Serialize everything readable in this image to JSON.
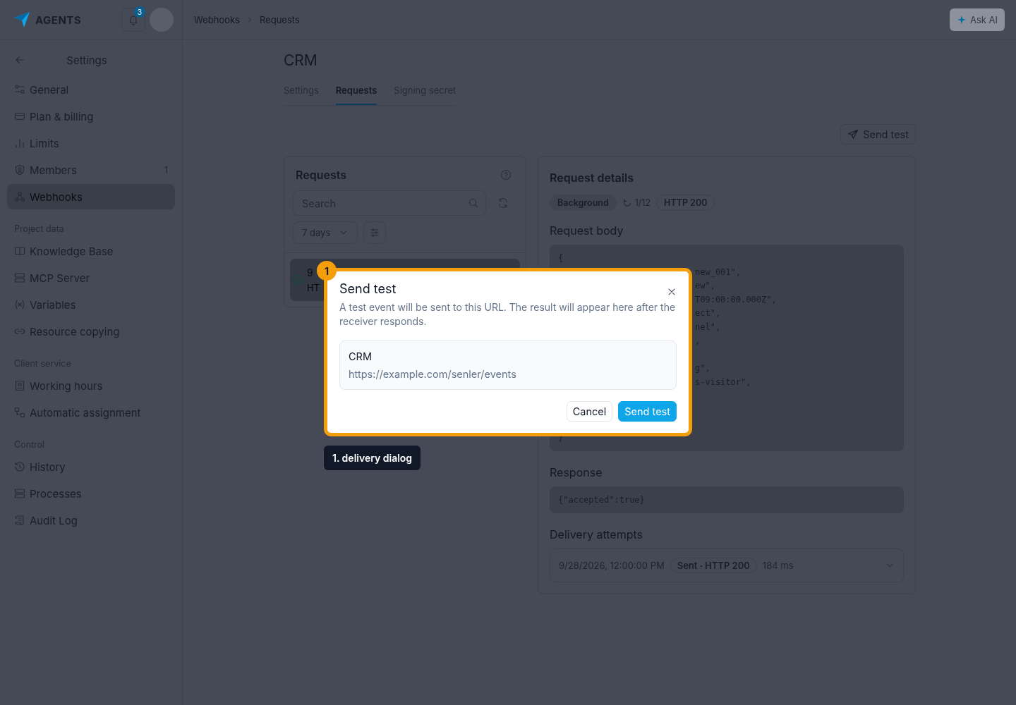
{
  "brand": {
    "name": "AGENTS"
  },
  "notifications": {
    "count": "3"
  },
  "breadcrumbs": [
    "Webhooks",
    "Requests"
  ],
  "ask_ai": {
    "label": "Ask AI"
  },
  "sidebar": {
    "title": "Settings",
    "sections": [
      {
        "items": [
          {
            "label": "General",
            "selected": false
          },
          {
            "label": "Plan & billing",
            "selected": false
          },
          {
            "label": "Limits",
            "selected": false
          },
          {
            "label": "Members",
            "count": "1",
            "selected": false
          },
          {
            "label": "Webhooks",
            "selected": true
          }
        ]
      },
      {
        "heading": "Project data",
        "items": [
          {
            "label": "Knowledge Base",
            "selected": false
          },
          {
            "label": "MCP Server",
            "selected": false
          },
          {
            "label": "Variables",
            "selected": false
          },
          {
            "label": "Resource copying",
            "selected": false
          }
        ]
      },
      {
        "heading": "Client service",
        "items": [
          {
            "label": "Working hours",
            "selected": false
          },
          {
            "label": "Automatic assignment",
            "selected": false
          }
        ]
      },
      {
        "heading": "Control",
        "items": [
          {
            "label": "History",
            "selected": false
          },
          {
            "label": "Processes",
            "selected": false
          },
          {
            "label": "Audit Log",
            "selected": false
          }
        ]
      }
    ]
  },
  "page": {
    "title": "CRM",
    "tabs": [
      {
        "label": "Settings",
        "selected": false
      },
      {
        "label": "Requests",
        "selected": true
      },
      {
        "label": "Signing secret",
        "selected": false
      }
    ],
    "send_test": "Send test"
  },
  "requests": {
    "title": "Requests",
    "search_placeholder": "Search",
    "period": "7 days",
    "rows": [
      {
        "time": "9",
        "status": "HT",
        "selected": true
      }
    ]
  },
  "details": {
    "title": "Request details",
    "tags": [
      {
        "kind": "tag",
        "label": "Background"
      },
      {
        "kind": "retry",
        "label": "1/12"
      },
      {
        "kind": "tag",
        "label": "HTTP 200"
      }
    ],
    "body_title": "Request body",
    "body_lines": [
      {
        "kind": "plain",
        "text": "{"
      },
      {
        "kind": "partial",
        "text": "new_001\","
      },
      {
        "kind": "partial",
        "text": "ew\","
      },
      {
        "kind": "partial",
        "text": "T09:00:00.000Z\","
      },
      {
        "kind": "partial",
        "text": "ect\","
      },
      {
        "kind": "partial",
        "text": "nel\","
      },
      {
        "kind": "partial",
        "text": ","
      },
      {
        "kind": "covered"
      },
      {
        "kind": "partial",
        "text": "g\","
      },
      {
        "kind": "partial",
        "text": "s-visitor\","
      },
      {
        "kind": "covered"
      },
      {
        "kind": "covered"
      },
      {
        "kind": "covered"
      },
      {
        "kind": "plain",
        "text": "}"
      }
    ],
    "response_title": "Response",
    "response": "{\"accepted\":true}",
    "attempts_title": "Delivery attempts",
    "attempts": [
      {
        "time": "9/28/2026, 12:00:00 PM",
        "status": "Sent · HTTP 200",
        "duration": "184 ms"
      }
    ]
  },
  "dialog": {
    "title": "Send test",
    "description": "A test event will be sent to this URL. The result will appear here after the receiver responds.",
    "target": {
      "name": "CRM",
      "url": "https://example.com/senler/events"
    },
    "buttons": [
      {
        "label": "Cancel",
        "kind": "secondary"
      },
      {
        "label": "Send test",
        "kind": "primary"
      }
    ]
  },
  "annotation": {
    "number": "1",
    "label": "1. delivery dialog"
  }
}
